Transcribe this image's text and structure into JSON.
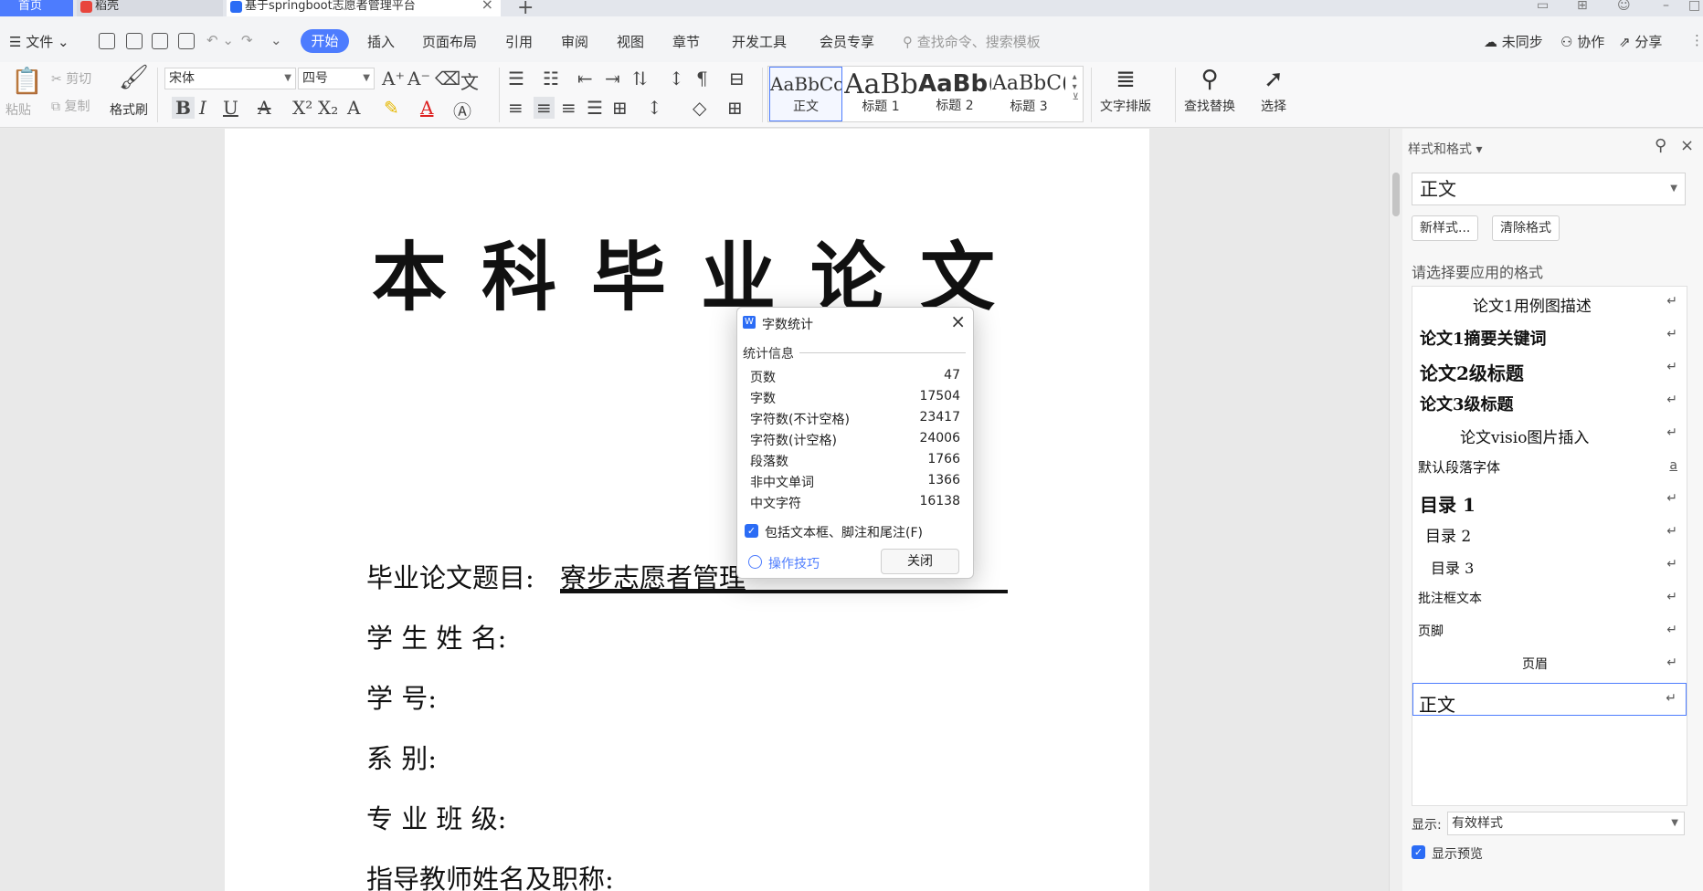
{
  "tabs": {
    "home": "首页",
    "daoke": "稻壳",
    "document": "基于springboot志愿者管理平台"
  },
  "menu": {
    "file": "文件",
    "items": [
      "开始",
      "插入",
      "页面布局",
      "引用",
      "审阅",
      "视图",
      "章节",
      "开发工具",
      "会员专享"
    ],
    "search_placeholder": "查找命令、搜索模板",
    "sync": "未同步",
    "collab": "协作",
    "share": "分享"
  },
  "toolbar": {
    "paste": "粘贴",
    "cut": "剪切",
    "copy": "复制",
    "format_painter": "格式刷",
    "font_name": "宋体",
    "font_size": "四号",
    "styles": [
      {
        "sample": "AaBbCcI",
        "name": "正文"
      },
      {
        "sample": "AaBb",
        "name": "标题 1"
      },
      {
        "sample": "AaBb(",
        "name": "标题 2"
      },
      {
        "sample": "AaBbC(",
        "name": "标题 3"
      }
    ],
    "text_layout": "文字排版",
    "find_replace": "查找替换",
    "select": "选择"
  },
  "document": {
    "title": "本科毕业论文",
    "fields": [
      {
        "label": "毕业论文题目:",
        "value": "寮步志愿者管理"
      },
      {
        "label": "学 生  姓 名:"
      },
      {
        "label": "学          号:"
      },
      {
        "label": "系          别:"
      },
      {
        "label": "专 业  班 级:"
      },
      {
        "label": "指导教师姓名及职称:"
      }
    ]
  },
  "dialog": {
    "title": "字数统计",
    "section": "统计信息",
    "stats": [
      {
        "label": "页数",
        "value": "47"
      },
      {
        "label": "字数",
        "value": "17504"
      },
      {
        "label": "字符数(不计空格)",
        "value": "23417"
      },
      {
        "label": "字符数(计空格)",
        "value": "24006"
      },
      {
        "label": "段落数",
        "value": "1766"
      },
      {
        "label": "非中文单词",
        "value": "1366"
      },
      {
        "label": "中文字符",
        "value": "16138"
      }
    ],
    "include_checkbox": "包括文本框、脚注和尾注(F)",
    "tips": "操作技巧",
    "close_button": "关闭"
  },
  "pane": {
    "title": "样式和格式",
    "current_style": "正文",
    "new_style": "新样式...",
    "clear_format": "清除格式",
    "hint": "请选择要应用的格式",
    "styles": [
      {
        "label": "论文1用例图描述",
        "mark": "↵"
      },
      {
        "label": "论文1摘要关键词",
        "mark": "↵"
      },
      {
        "label": "论文2级标题",
        "mark": "↵"
      },
      {
        "label": "论文3级标题",
        "mark": "↵"
      },
      {
        "label": "论文visio图片插入",
        "mark": "↵"
      },
      {
        "label": "默认段落字体",
        "mark": "a"
      },
      {
        "label": "目录 1",
        "mark": "↵"
      },
      {
        "label": "目录 2",
        "mark": "↵"
      },
      {
        "label": "目录 3",
        "mark": "↵"
      },
      {
        "label": "批注框文本",
        "mark": "↵"
      },
      {
        "label": "页脚",
        "mark": "↵"
      },
      {
        "label": "页眉",
        "mark": "↵"
      },
      {
        "label": "正文",
        "mark": "↵"
      }
    ],
    "show_label": "显示:",
    "show_value": "有效样式",
    "show_preview": "显示预览"
  },
  "colors": {
    "accent": "#4d7cfe",
    "wps_blue": "#2b6cf5"
  }
}
